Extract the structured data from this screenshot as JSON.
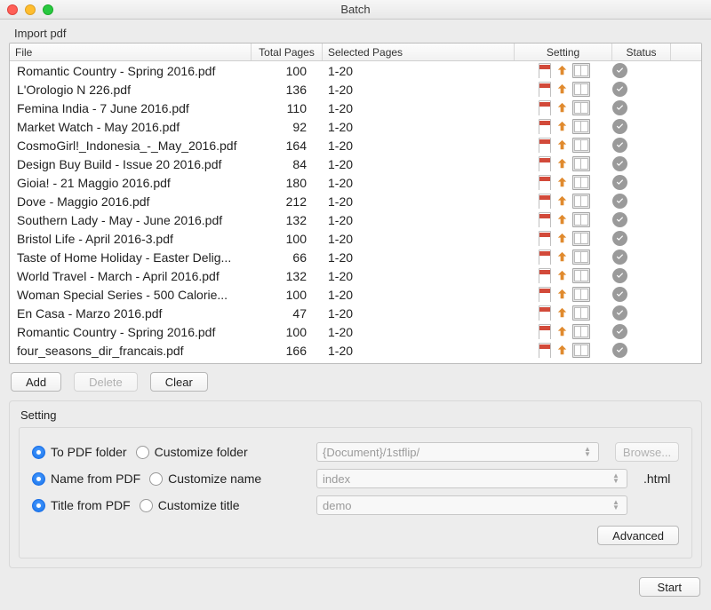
{
  "window": {
    "title": "Batch"
  },
  "import": {
    "section_label": "Import pdf",
    "columns": {
      "file": "File",
      "total_pages": "Total Pages",
      "selected_pages": "Selected Pages",
      "setting": "Setting",
      "status": "Status"
    },
    "rows": [
      {
        "file": "Romantic Country - Spring 2016.pdf",
        "total_pages": 100,
        "selected_pages": "1-20"
      },
      {
        "file": "L'Orologio N 226.pdf",
        "total_pages": 136,
        "selected_pages": "1-20"
      },
      {
        "file": "Femina India - 7 June 2016.pdf",
        "total_pages": 110,
        "selected_pages": "1-20"
      },
      {
        "file": "Market Watch - May 2016.pdf",
        "total_pages": 92,
        "selected_pages": "1-20"
      },
      {
        "file": "CosmoGirl!_Indonesia_-_May_2016.pdf",
        "total_pages": 164,
        "selected_pages": "1-20"
      },
      {
        "file": "Design Buy Build - Issue 20 2016.pdf",
        "total_pages": 84,
        "selected_pages": "1-20"
      },
      {
        "file": "Gioia! - 21 Maggio 2016.pdf",
        "total_pages": 180,
        "selected_pages": "1-20"
      },
      {
        "file": "Dove - Maggio 2016.pdf",
        "total_pages": 212,
        "selected_pages": "1-20"
      },
      {
        "file": "Southern Lady - May - June 2016.pdf",
        "total_pages": 132,
        "selected_pages": "1-20"
      },
      {
        "file": "Bristol Life - April 2016-3.pdf",
        "total_pages": 100,
        "selected_pages": "1-20"
      },
      {
        "file": "Taste of Home Holiday - Easter Delig...",
        "total_pages": 66,
        "selected_pages": "1-20"
      },
      {
        "file": "World Travel - March - April 2016.pdf",
        "total_pages": 132,
        "selected_pages": "1-20"
      },
      {
        "file": "Woman Special Series - 500 Calorie...",
        "total_pages": 100,
        "selected_pages": "1-20"
      },
      {
        "file": "En Casa - Marzo 2016.pdf",
        "total_pages": 47,
        "selected_pages": "1-20"
      },
      {
        "file": "Romantic Country - Spring 2016.pdf",
        "total_pages": 100,
        "selected_pages": "1-20"
      },
      {
        "file": "four_seasons_dir_francais.pdf",
        "total_pages": 166,
        "selected_pages": "1-20"
      }
    ]
  },
  "buttons": {
    "add": "Add",
    "delete": "Delete",
    "clear": "Clear",
    "browse": "Browse...",
    "advanced": "Advanced",
    "start": "Start"
  },
  "settings": {
    "section_label": "Setting",
    "folder": {
      "default_label": "To PDF folder",
      "custom_label": "Customize folder",
      "placeholder": "{Document}/1stflip/",
      "selected": "default"
    },
    "name": {
      "default_label": "Name from PDF",
      "custom_label": "Customize name",
      "placeholder": "index",
      "suffix": ".html",
      "selected": "default"
    },
    "title": {
      "default_label": "Title from PDF",
      "custom_label": "Customize title",
      "placeholder": "demo",
      "selected": "default"
    }
  }
}
